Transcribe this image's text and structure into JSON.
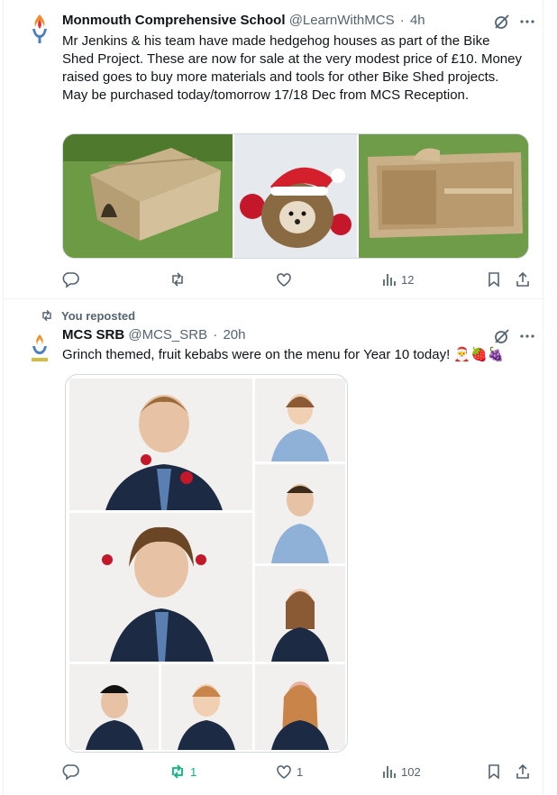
{
  "tweet1": {
    "name": "Monmouth Comprehensive School",
    "handle": "@LearnWithMCS",
    "separator": "·",
    "time": "4h",
    "text": "Mr Jenkins & his team have made hedgehog houses as part of the Bike Shed Project. These are now for sale at the very modest price of £10. Money raised goes to buy more materials and tools for other Bike Shed projects. May be purchased today/tomorrow 17/18 Dec from MCS Reception.",
    "actions": {
      "views": "12"
    }
  },
  "tweet2": {
    "repost_label": "You reposted",
    "name": "MCS SRB",
    "handle": "@MCS_SRB",
    "separator": "·",
    "time": "20h",
    "text": "Grinch themed, fruit kebabs were on the menu for Year 10 today! 🎅🍓🍇",
    "actions": {
      "reposts": "1",
      "likes": "1",
      "views": "102"
    }
  },
  "colors": {
    "accent_green": "#00ba7c",
    "muted": "#536471",
    "border": "#eff3f4"
  },
  "icons": [
    "school-logo-icon",
    "grok-icon",
    "more-icon",
    "reply-icon",
    "retweet-icon",
    "like-icon",
    "views-icon",
    "bookmark-icon",
    "share-icon"
  ]
}
